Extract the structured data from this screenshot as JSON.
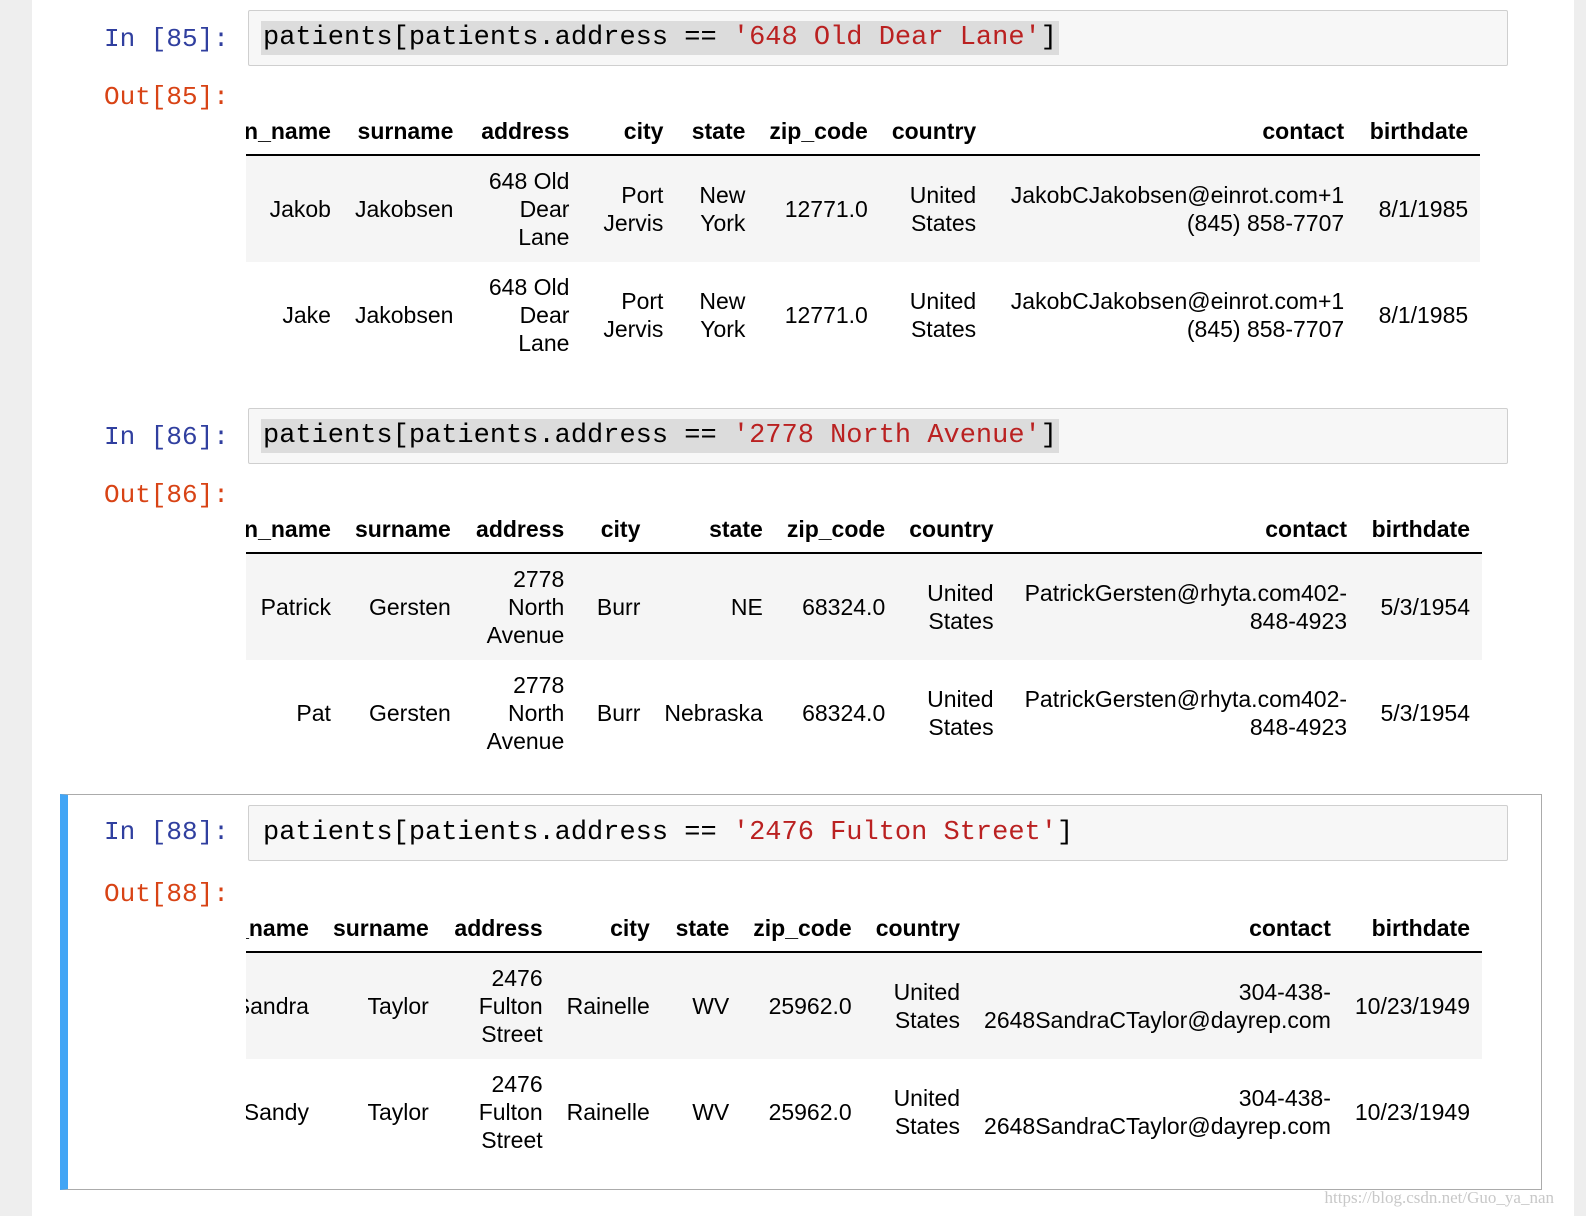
{
  "cells": [
    {
      "in_prompt": "In [85]:",
      "code_prefix": "patients[patients.address == ",
      "code_string": "'648 Old Dear Lane'",
      "code_suffix": "]",
      "out_prompt": "Out[85]:",
      "columns": [
        "given_name",
        "surname",
        "address",
        "city",
        "state",
        "zip_code",
        "country",
        "contact",
        "birthdate"
      ],
      "rows": [
        [
          "Jakob",
          "Jakobsen",
          "648 Old Dear Lane",
          "Port Jervis",
          "New York",
          "12771.0",
          "United States",
          "JakobCJakobsen@einrot.com+1 (845) 858-7707",
          "8/1/1985"
        ],
        [
          "Jake",
          "Jakobsen",
          "648 Old Dear Lane",
          "Port Jervis",
          "New York",
          "12771.0",
          "United States",
          "JakobCJakobsen@einrot.com+1 (845) 858-7707",
          "8/1/1985"
        ]
      ]
    },
    {
      "in_prompt": "In [86]:",
      "code_prefix": "patients[patients.address == ",
      "code_string": "'2778 North Avenue'",
      "code_suffix": "]",
      "out_prompt": "Out[86]:",
      "columns": [
        "given_name",
        "surname",
        "address",
        "city",
        "state",
        "zip_code",
        "country",
        "contact",
        "birthdate"
      ],
      "rows": [
        [
          "Patrick",
          "Gersten",
          "2778 North Avenue",
          "Burr",
          "NE",
          "68324.0",
          "United States",
          "PatrickGersten@rhyta.com402-848-4923",
          "5/3/1954"
        ],
        [
          "Pat",
          "Gersten",
          "2778 North Avenue",
          "Burr",
          "Nebraska",
          "68324.0",
          "United States",
          "PatrickGersten@rhyta.com402-848-4923",
          "5/3/1954"
        ]
      ]
    },
    {
      "in_prompt": "In [88]:",
      "code_prefix": "patients[patients.address == ",
      "code_string": "'2476 Fulton Street'",
      "code_suffix": "]",
      "out_prompt": "Out[88]:",
      "columns": [
        "given_name",
        "surname",
        "address",
        "city",
        "state",
        "zip_code",
        "country",
        "contact",
        "birthdate"
      ],
      "rows": [
        [
          "Sandra",
          "Taylor",
          "2476 Fulton Street",
          "Rainelle",
          "WV",
          "25962.0",
          "United States",
          "304-438-2648SandraCTaylor@dayrep.com",
          "10/23/1949"
        ],
        [
          "Sandy",
          "Taylor",
          "2476 Fulton Street",
          "Rainelle",
          "WV",
          "25962.0",
          "United States",
          "304-438-2648SandraCTaylor@dayrep.com",
          "10/23/1949"
        ]
      ]
    }
  ],
  "watermark": "https://blog.csdn.net/Guo_ya_nan"
}
